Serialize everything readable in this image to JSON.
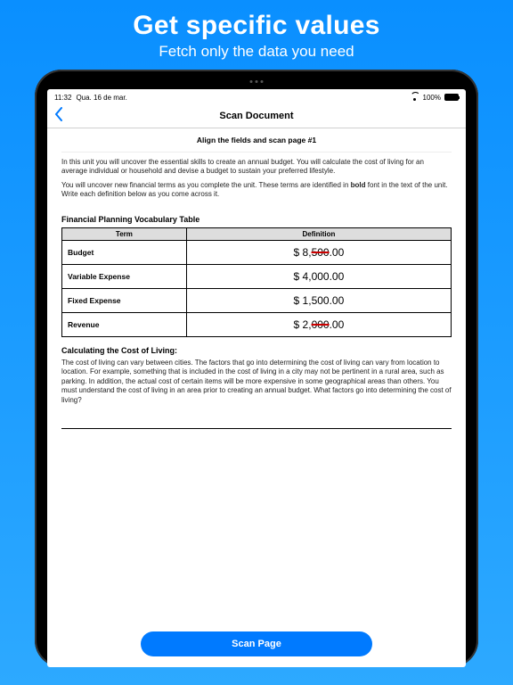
{
  "promo": {
    "title": "Get specific values",
    "subtitle": "Fetch only the data you need"
  },
  "statusbar": {
    "time": "11:32",
    "date": "Qua. 16 de mar.",
    "battery_pct": "100%"
  },
  "nav": {
    "title": "Scan Document"
  },
  "page": {
    "align_instruction": "Align the fields and scan page #1",
    "intro1": "In this unit you will uncover the essential skills to create an annual budget. You will calculate the cost of living for an average individual or household and devise a budget to sustain your preferred lifestyle.",
    "intro2a": "You will uncover new financial terms as you complete the unit. These terms are identified in ",
    "intro2bold": "bold",
    "intro2b": " font in the text of the unit. Write each definition below as you come across it.",
    "vocab_title": "Financial Planning Vocabulary Table",
    "vocab_headers": {
      "term": "Term",
      "definition": "Definition"
    },
    "vocab": [
      {
        "term": "Budget",
        "value": "$ 8,500.00",
        "struck": "500"
      },
      {
        "term": "Variable Expense",
        "value": "$ 4,000.00"
      },
      {
        "term": "Fixed Expense",
        "value": "$ 1,500.00"
      },
      {
        "term": "Revenue",
        "value": "$ 2,000.00",
        "struck": "000"
      }
    ],
    "section2_title": "Calculating the Cost of Living:",
    "section2_body": "The cost of living can vary between cities. The factors that go into determining the cost of living can vary from location to location. For example, something that is included in the cost of living in a city may not be pertinent in a rural area, such as parking. In addition, the actual cost of certain items will be more expensive in some geographical areas than others. You must understand the cost of living in an area prior to creating an annual budget. What factors go into determining the cost of living?",
    "scan_button": "Scan Page"
  }
}
